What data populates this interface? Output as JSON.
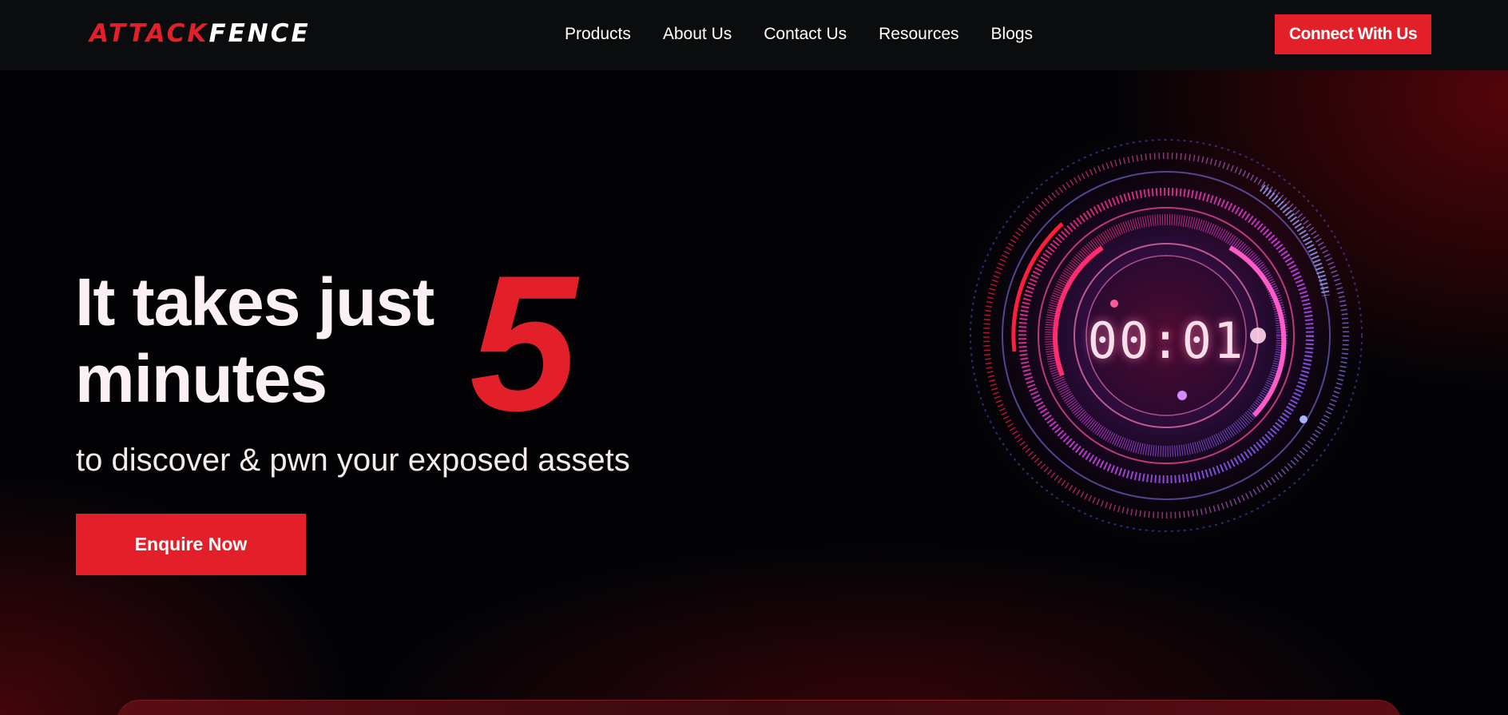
{
  "brand": {
    "logo_part1": "ATTACK",
    "logo_part2": "FENCE",
    "accent_color": "#e3202a"
  },
  "nav": {
    "items": [
      {
        "label": "Products"
      },
      {
        "label": "About Us"
      },
      {
        "label": "Contact Us"
      },
      {
        "label": "Resources"
      },
      {
        "label": "Blogs"
      }
    ],
    "cta_label": "Connect With Us"
  },
  "hero": {
    "title_line1": "It takes just",
    "title_line2": "minutes",
    "big_number": "5",
    "subtitle": "to discover & pwn your exposed assets",
    "cta_label": "Enquire Now"
  },
  "timer": {
    "display": "00:01"
  },
  "icons": [
    "logo",
    "clock-dial-graphic"
  ]
}
